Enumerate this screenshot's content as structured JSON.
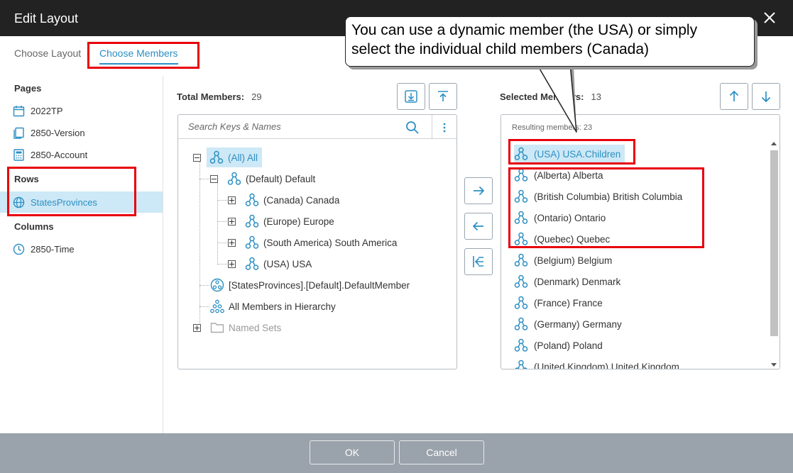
{
  "window": {
    "title": "Edit Layout",
    "close_icon": "close-icon"
  },
  "tabs": [
    {
      "label": "Choose Layout",
      "active": false
    },
    {
      "label": "Choose Members",
      "active": true
    }
  ],
  "sidebar": {
    "pages_label": "Pages",
    "pages": [
      {
        "label": "2022TP",
        "icon": "calendar-icon"
      },
      {
        "label": "2850-Version",
        "icon": "copy-icon"
      },
      {
        "label": "2850-Account",
        "icon": "calculator-icon"
      }
    ],
    "rows_label": "Rows",
    "rows": [
      {
        "label": "StatesProvinces",
        "icon": "globe-icon",
        "selected": true
      }
    ],
    "columns_label": "Columns",
    "columns": [
      {
        "label": "2850-Time",
        "icon": "clock-icon"
      }
    ]
  },
  "total_members": {
    "label": "Total Members:",
    "count": "29",
    "search_placeholder": "Search Keys & Names",
    "tree": [
      {
        "label": "(All) All",
        "expander": "minus",
        "selected": true,
        "icon": "hierarchy-icon"
      },
      {
        "label": "(Default) Default",
        "expander": "minus",
        "icon": "hierarchy-icon"
      },
      {
        "label": "(Canada) Canada",
        "expander": "plus",
        "icon": "hierarchy-icon"
      },
      {
        "label": "(Europe) Europe",
        "expander": "plus",
        "icon": "hierarchy-icon"
      },
      {
        "label": "(South America) South America",
        "expander": "plus",
        "icon": "hierarchy-icon"
      },
      {
        "label": "(USA) USA",
        "expander": "plus",
        "icon": "hierarchy-icon"
      },
      {
        "label": "[StatesProvinces].[Default].DefaultMember",
        "icon": "default-member-icon"
      },
      {
        "label": "All Members in Hierarchy",
        "icon": "all-members-icon"
      },
      {
        "label": "Named Sets",
        "expander": "plus",
        "icon": "folder-icon",
        "disabled": true
      }
    ]
  },
  "selected_members": {
    "label": "Selected Members:",
    "count": "13",
    "resulting_label": "Resulting members: 23",
    "items": [
      {
        "label": "(USA) USA.Children",
        "selected": true
      },
      {
        "label": "(Alberta) Alberta"
      },
      {
        "label": "(British Columbia) British Columbia"
      },
      {
        "label": "(Ontario) Ontario"
      },
      {
        "label": "(Quebec) Quebec"
      },
      {
        "label": "(Belgium) Belgium"
      },
      {
        "label": "(Denmark) Denmark"
      },
      {
        "label": "(France) France"
      },
      {
        "label": "(Germany) Germany"
      },
      {
        "label": "(Poland) Poland"
      },
      {
        "label": "(United Kingdom) United Kingdom"
      }
    ]
  },
  "callout": {
    "line1": "You can use a dynamic member (the USA) or simply",
    "line2": "select the individual child members (Canada)"
  },
  "footer": {
    "ok_label": "OK",
    "cancel_label": "Cancel"
  },
  "colors": {
    "accent": "#2b8fc3",
    "selection": "#cde8f6",
    "highlight_box": "#e8000b",
    "titlebar": "#222222",
    "footer": "#9aa2ab"
  }
}
